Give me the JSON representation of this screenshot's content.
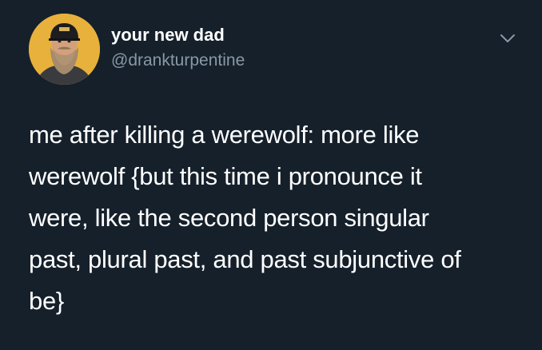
{
  "tweet": {
    "author": {
      "display_name": "your new dad",
      "handle": "@drankturpentine",
      "avatar_icon": "bearded-man-avatar"
    },
    "menu_icon": "chevron-down-icon",
    "text_lines": [
      "me after killing a werewolf: more like",
      "werewolf {but this time i pronounce it",
      "were, like the second person singular",
      "past, plural past, and past subjunctive of",
      "be}"
    ]
  },
  "colors": {
    "background": "#15202b",
    "primary_text": "#ffffff",
    "secondary_text": "#8899a6",
    "avatar_bg": "#e9b23a"
  }
}
